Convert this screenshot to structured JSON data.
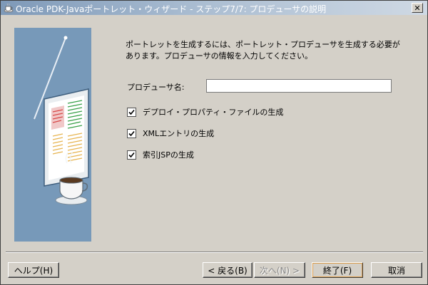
{
  "window": {
    "title": "Oracle PDK-Javaポートレット・ウィザード - ステップ7/7: プロデューサの説明"
  },
  "main": {
    "description": "ポートレットを生成するには、ポートレット・プロデューサを生成する必要があります。プロデューサの情報を入力してください。",
    "producer_name_label": "プロデューサ名:",
    "producer_name_value": "",
    "options": [
      {
        "label": "デプロイ・プロパティ・ファイルの生成",
        "checked": true
      },
      {
        "label": "XMLエントリの生成",
        "checked": true
      },
      {
        "label": "索引JSPの生成",
        "checked": true
      }
    ]
  },
  "buttons": {
    "help": "ヘルプ(H)",
    "back": "< 戻る(B)",
    "next": "次へ(N) >",
    "finish": "終了(F)",
    "cancel": "取消"
  },
  "icons": {
    "app": "coffee-cup-icon",
    "close": "close-icon"
  },
  "colors": {
    "titlebar_start": "#7e99b8",
    "art_panel": "#6f92b3",
    "dialog": "#d4d0c8"
  }
}
